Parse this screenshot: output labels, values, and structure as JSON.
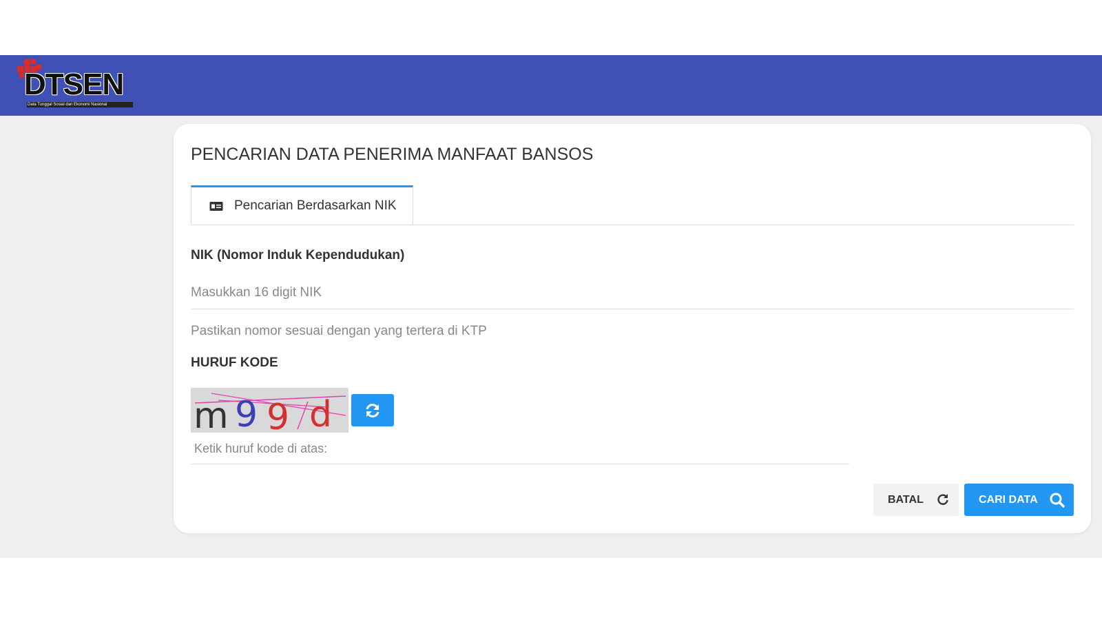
{
  "header": {
    "logo_text": "DTSEN",
    "logo_tagline": "Data Tunggal Sosial dan Ekonomi Nasional",
    "background_color": "#3f51b5"
  },
  "main": {
    "title": "PENCARIAN DATA PENERIMA MANFAAT BANSOS",
    "tabs": [
      {
        "label": "Pencarian Berdasarkan NIK",
        "icon": "id-card-icon",
        "active": true
      }
    ],
    "nik_field": {
      "label": "NIK (Nomor Induk Kependudukan)",
      "placeholder": "Masukkan 16 digit NIK",
      "value": "",
      "helper": "Pastikan nomor sesuai dengan yang tertera di KTP"
    },
    "captcha": {
      "label": "HURUF KODE",
      "code": "m99d",
      "refresh_icon": "refresh-icon",
      "input_placeholder": "Ketik huruf kode di atas:",
      "input_value": ""
    },
    "buttons": {
      "cancel_label": "BATAL",
      "cancel_icon": "reset-icon",
      "search_label": "CARI DATA",
      "search_icon": "search-icon"
    }
  },
  "colors": {
    "accent": "#2196f3",
    "page_background": "#efeff0"
  }
}
